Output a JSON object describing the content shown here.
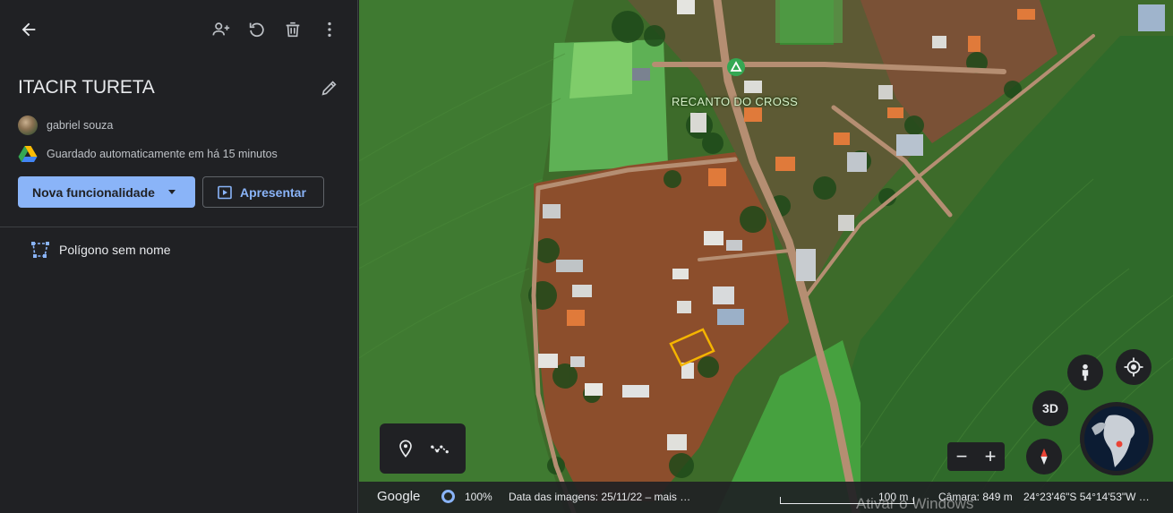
{
  "project": {
    "title": "ITACIR TURETA",
    "owner": "gabriel souza",
    "saved_status": "Guardado automaticamente em há 15 minutos"
  },
  "toolbar": {
    "back_icon": "arrow-back-icon",
    "share_icon": "person-add-icon",
    "undo_icon": "refresh-icon",
    "delete_icon": "trash-icon",
    "more_icon": "more-vert-icon",
    "edit_icon": "pencil-icon"
  },
  "actions": {
    "new_feature_label": "Nova funcionalidade",
    "present_label": "Apresentar"
  },
  "features": [
    {
      "label": "Polígono sem nome",
      "icon": "polygon-icon"
    }
  ],
  "map": {
    "place_label": "RECANTO DO CROSS",
    "controls": {
      "btn_3d": "3D",
      "zoom_out": "−",
      "zoom_in": "+"
    },
    "status": {
      "logo": "Google",
      "stream_percent": "100%",
      "imagery_date": "Data das imagens: 25/11/22 – mais …",
      "scale": "100 m",
      "camera": "Câmara: 849 m",
      "coordinates": "24°23'46\"S 54°14'53\"W …"
    },
    "watermark": "Ativar o Windows"
  },
  "colors": {
    "accent": "#8ab4f8",
    "panel_bg": "#202124",
    "polygon_outline": "#f4b400"
  }
}
